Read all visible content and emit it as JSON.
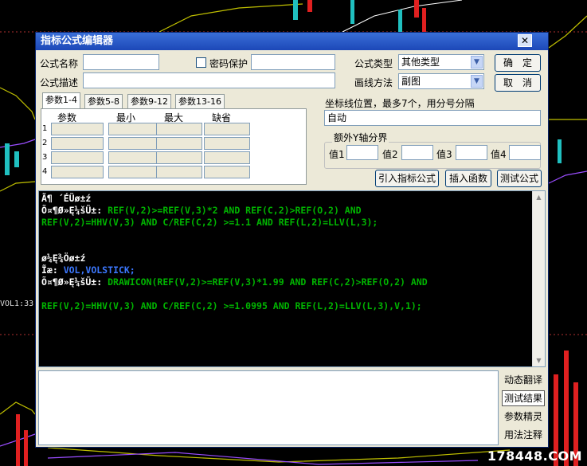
{
  "background": {
    "watermark": "178448.COM",
    "left_indicator_text": "VOL1:33"
  },
  "window": {
    "title": "指标公式编辑器",
    "close_glyph": "✕"
  },
  "form": {
    "formula_name_label": "公式名称",
    "formula_name_value": "",
    "password_label": "密码保护",
    "password_checked": false,
    "password_value": "",
    "formula_type_label": "公式类型",
    "formula_type_value": "其他类型",
    "ok_label": "确　定",
    "cancel_label": "取　消",
    "formula_desc_label": "公式描述",
    "formula_desc_value": "",
    "draw_method_label": "画线方法",
    "draw_method_value": "副图"
  },
  "params": {
    "tabs": [
      "参数1-4",
      "参数5-8",
      "参数9-12",
      "参数13-16"
    ],
    "active_tab": 0,
    "headers": [
      "参数",
      "最小",
      "最大",
      "缺省"
    ],
    "row_numbers": [
      "1",
      "2",
      "3",
      "4"
    ]
  },
  "axis": {
    "label": "坐标线位置，最多7个，用分号分隔",
    "value": "自动",
    "group_label": "额外Y轴分界",
    "fields": [
      "值1",
      "值2",
      "值3",
      "值4"
    ]
  },
  "actions": {
    "import_label": "引入指标公式",
    "insert_fn_label": "插入函数",
    "test_label": "测试公式"
  },
  "code_lines": {
    "l1": "Ã¶ ´ÉÜø±ź",
    "l2a": "Õ¤¶Ø»Ę¼šÜ±: ",
    "l2b": "REF(V,2)>=REF(V,3)*2 AND REF(C,2)>REF(O,2) AND",
    "l3": "REF(V,2)=HHV(V,3) AND C/REF(C,2) >=1.1 AND REF(L,2)=LLV(L,3);",
    "l4": "ø¼Ę¾Öø±ź",
    "l5a": "Ĩæ: ",
    "l5b": "VOL,VOLSTICK;",
    "l6a": "Õ¤¶Ø»Ę¼šÜ±: ",
    "l6b": "DRAWICON(REF(V,2)>=REF(V,3)*1.99 AND REF(C,2)>REF(O,2) AND",
    "l7": "REF(V,2)=HHV(V,3) AND C/REF(C,2) >=1.0995 AND REF(L,2)=LLV(L,3),V,1);"
  },
  "side_buttons": [
    "动态翻译",
    "测试结果",
    "参数精灵",
    "用法注释"
  ],
  "selected_side_button": 1,
  "colors": {
    "keyword_green": "#00b400",
    "title_bar": "#1c48b8",
    "dialog_bg": "#ece9d8"
  }
}
